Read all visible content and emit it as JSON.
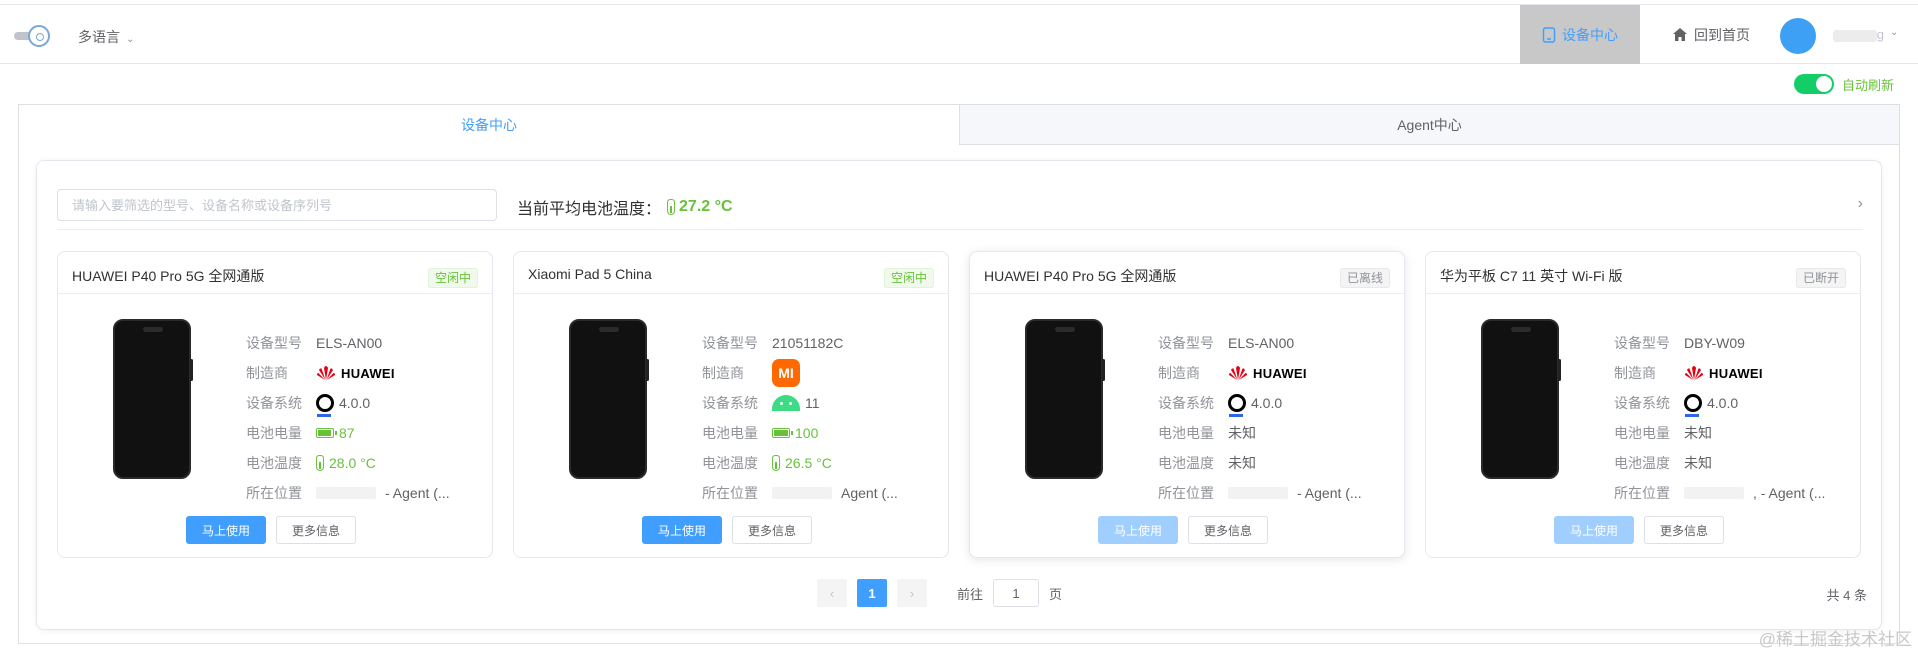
{
  "header": {
    "language_label": "多语言",
    "nav_device_center": "设备中心",
    "nav_home": "回到首页",
    "user_suffix": "g"
  },
  "auto_refresh": {
    "label": "自动刷新",
    "enabled": true
  },
  "tabs": [
    {
      "label": "设备中心",
      "active": true
    },
    {
      "label": "Agent中心",
      "active": false
    }
  ],
  "search": {
    "placeholder": "请输入要筛选的型号、设备名称或设备序列号",
    "value": ""
  },
  "summary": {
    "label": "当前平均电池温度：",
    "value": "27.2 °C"
  },
  "field_labels": {
    "model": "设备型号",
    "manufacturer": "制造商",
    "os": "设备系统",
    "battery_level": "电池电量",
    "battery_temp": "电池温度",
    "location": "所在位置"
  },
  "devices": [
    {
      "name": "HUAWEI P40 Pro 5G 全网通版",
      "status": "空闲中",
      "model": "ELS-AN00",
      "manufacturer": "HUAWEI",
      "os_version": "4.0.0",
      "battery": "87",
      "temperature": "28.0 °C",
      "location": "- Agent (...",
      "use_label": "马上使用",
      "more_label": "更多信息"
    },
    {
      "name": "Xiaomi Pad 5 China",
      "status": "空闲中",
      "model": "21051182C",
      "manufacturer": "MI",
      "os_version": "11",
      "battery": "100",
      "temperature": "26.5 °C",
      "location": "Agent (...",
      "use_label": "马上使用",
      "more_label": "更多信息"
    },
    {
      "name": "HUAWEI P40 Pro 5G 全网通版",
      "status": "已离线",
      "model": "ELS-AN00",
      "manufacturer": "HUAWEI",
      "os_version": "4.0.0",
      "battery": "未知",
      "temperature": "未知",
      "location": "- Agent (...",
      "use_label": "马上使用",
      "more_label": "更多信息"
    },
    {
      "name": "华为平板 C7 11 英寸 Wi-Fi 版",
      "status": "已断开",
      "model": "DBY-W09",
      "manufacturer": "HUAWEI",
      "os_version": "4.0.0",
      "battery": "未知",
      "temperature": "未知",
      "location": ", - Agent (...",
      "use_label": "马上使用",
      "more_label": "更多信息"
    }
  ],
  "pagination": {
    "prev": "‹",
    "current": "1",
    "next": "›",
    "goto_label": "前往",
    "goto_value": "1",
    "page_suffix": "页",
    "total": "共 4 条"
  },
  "watermark": "@稀土掘金技术社区",
  "colors": {
    "primary": "#409eff",
    "success": "#67c23a",
    "muted": "#909399",
    "huawei_red": "#e60012",
    "mi_orange": "#ff6900"
  }
}
